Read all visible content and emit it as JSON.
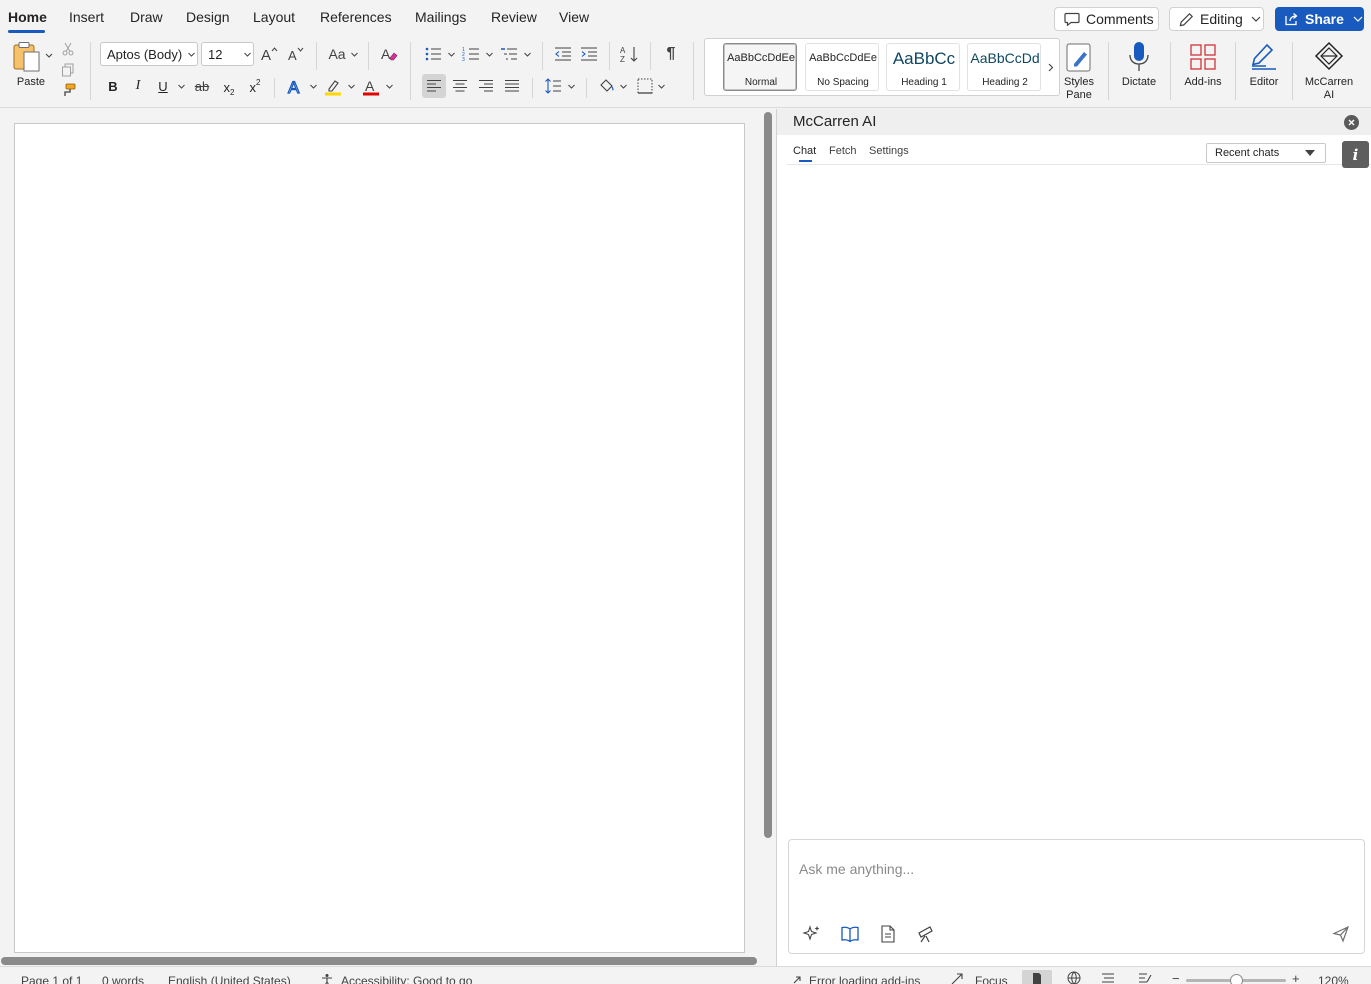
{
  "tabs": [
    {
      "label": "Home",
      "active": true
    },
    {
      "label": "Insert"
    },
    {
      "label": "Draw"
    },
    {
      "label": "Design"
    },
    {
      "label": "Layout"
    },
    {
      "label": "References"
    },
    {
      "label": "Mailings"
    },
    {
      "label": "Review"
    },
    {
      "label": "View"
    }
  ],
  "top_buttons": {
    "comments": "Comments",
    "editing": "Editing",
    "share": "Share"
  },
  "ribbon": {
    "paste_label": "Paste",
    "font_family": "Aptos (Body)",
    "font_size": "12",
    "change_case_label": "Aa",
    "bold": "B",
    "italic": "I",
    "underline": "U",
    "strikethrough": "ab",
    "subscript": "x",
    "superscript": "x",
    "styles": [
      {
        "sample": "AaBbCcDdEe",
        "name": "Normal",
        "selected": true
      },
      {
        "sample": "AaBbCcDdEe",
        "name": "No Spacing"
      },
      {
        "sample": "AaBbCc",
        "name": "Heading 1"
      },
      {
        "sample": "AaBbCcDd",
        "name": "Heading 2"
      }
    ],
    "styles_pane_label": "Styles Pane",
    "dictate_label": "Dictate",
    "addins_label": "Add-ins",
    "editor_label": "Editor",
    "mccarren_label": "McCarren AI"
  },
  "pane": {
    "title": "McCarren AI",
    "tabs": [
      {
        "label": "Chat",
        "active": true
      },
      {
        "label": "Fetch"
      },
      {
        "label": "Settings"
      }
    ],
    "recent_chats": "Recent chats",
    "info_label": "i",
    "chat_placeholder": "Ask me anything..."
  },
  "status": {
    "page": "Page 1 of 1",
    "words": "0 words",
    "language": "English (United States)",
    "accessibility": "Accessibility: Good to go",
    "addins_error": "Error loading add-ins",
    "focus": "Focus",
    "zoom": "120%"
  },
  "colors": {
    "accent": "#185abd",
    "highlight": "#ffd700",
    "font_color": "#e00000",
    "addins_icon": "#d13438"
  }
}
